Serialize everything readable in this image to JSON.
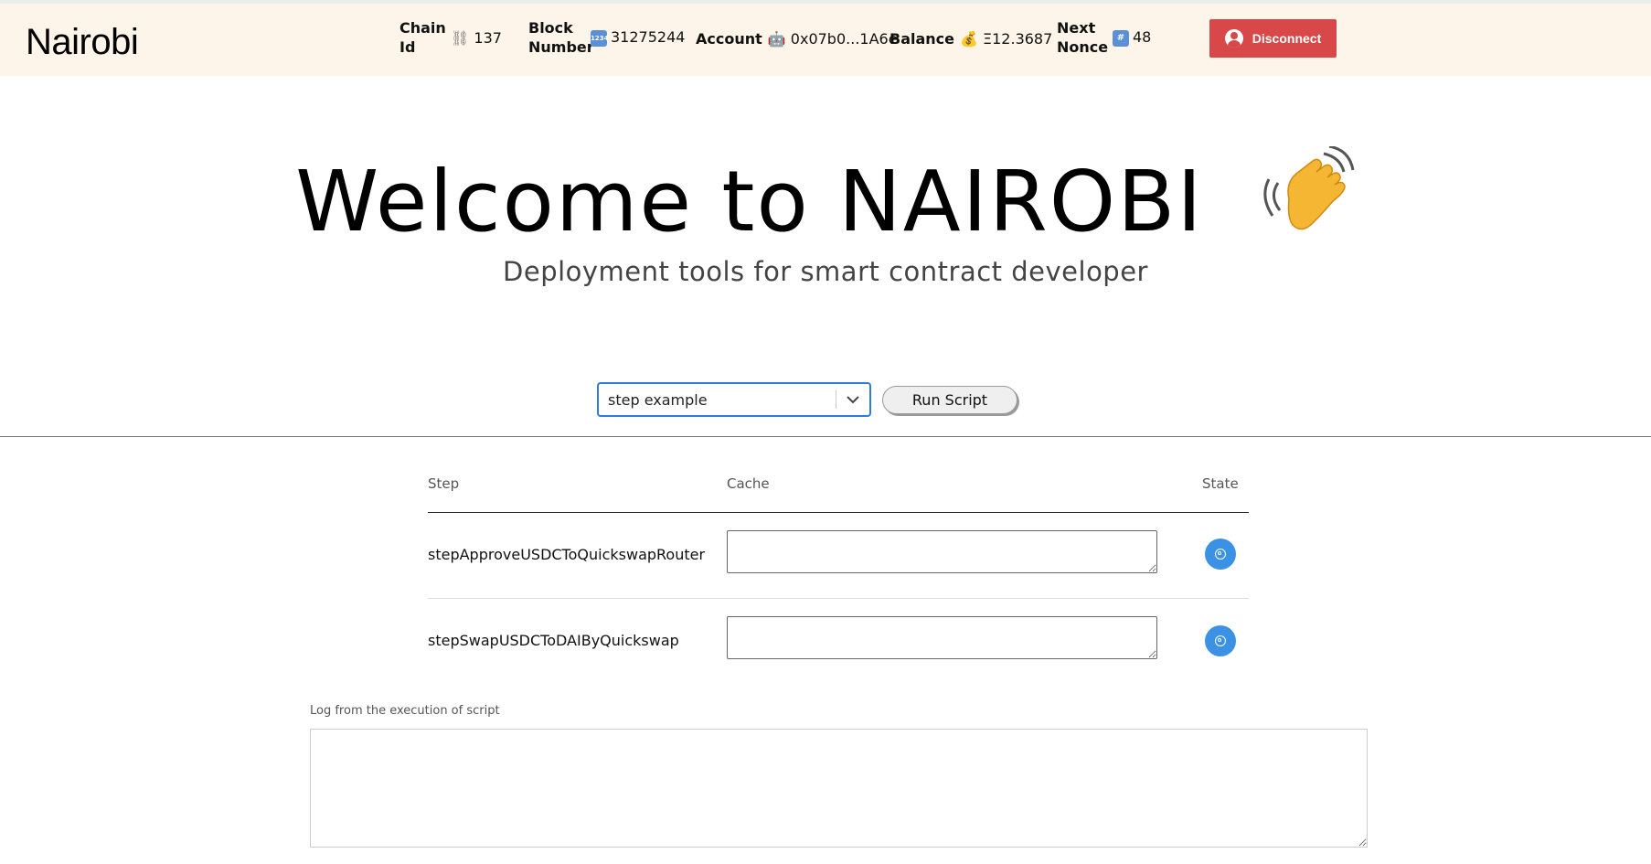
{
  "header": {
    "brand": "Nairobi",
    "stats": [
      {
        "label": "Chain Id",
        "icon": "chain-icon",
        "glyph": "⛓",
        "value": "137"
      },
      {
        "label": "Block Number",
        "icon": "numbers-icon",
        "glyph": "1234",
        "value": "31275244"
      },
      {
        "label": "Account",
        "icon": "robot-icon",
        "glyph": "🤖",
        "value": "0x07b0...1A6e"
      },
      {
        "label": "Balance",
        "icon": "money-bag-icon",
        "glyph": "💰",
        "value": "Ξ12.3687"
      },
      {
        "label": "Next Nonce",
        "icon": "hash-icon",
        "glyph": "#",
        "value": "48"
      }
    ],
    "disconnect_label": "Disconnect",
    "accent": "#d94848"
  },
  "hero": {
    "title": "Welcome to NAIROBI",
    "subtitle": "Deployment tools for smart contract developer"
  },
  "controls": {
    "script_select_value": "step example",
    "run_label": "Run Script"
  },
  "steps_table": {
    "headers": {
      "step": "Step",
      "cache": "Cache",
      "state": "State"
    },
    "rows": [
      {
        "step": "stepApproveUSDCToQuickswapRouter",
        "cache": ""
      },
      {
        "step": "stepSwapUSDCToDAIByQuickswap",
        "cache": ""
      }
    ],
    "state_color": "#3b92e4"
  },
  "log": {
    "label": "Log from the execution of script",
    "value": ""
  }
}
